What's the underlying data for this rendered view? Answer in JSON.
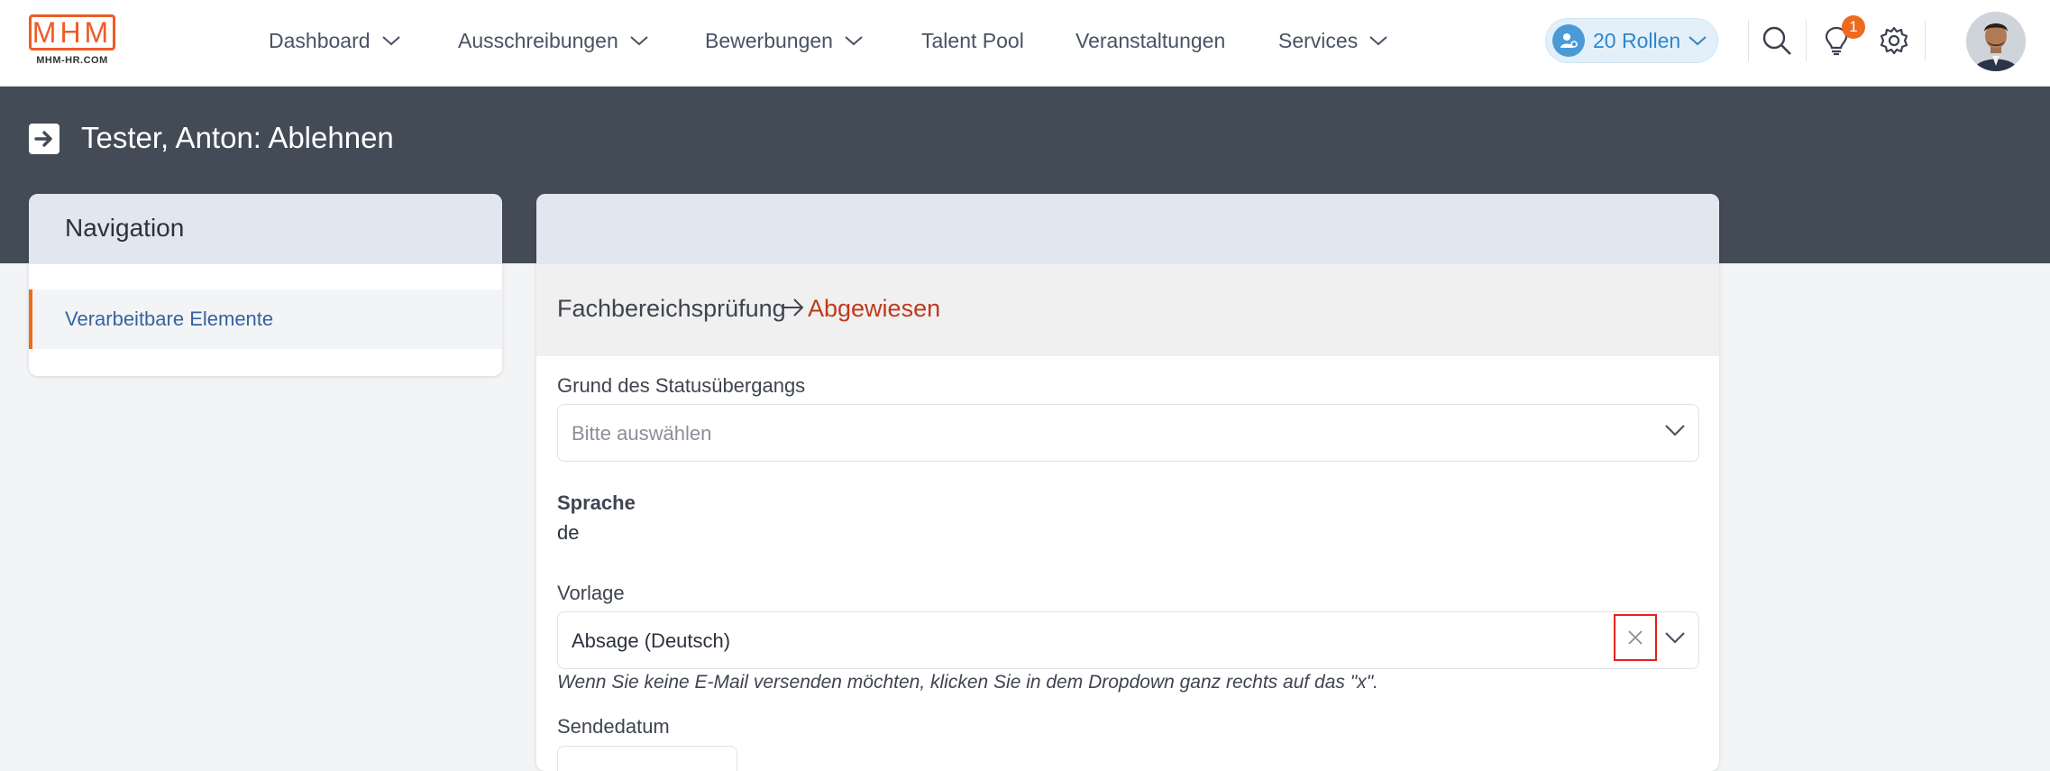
{
  "logo": {
    "letters": "MHM",
    "sub": "MHM-HR.COM"
  },
  "nav": {
    "items": [
      {
        "label": "Dashboard",
        "dropdown": true
      },
      {
        "label": "Ausschreibungen",
        "dropdown": true
      },
      {
        "label": "Bewerbungen",
        "dropdown": true
      },
      {
        "label": "Talent Pool",
        "dropdown": false
      },
      {
        "label": "Veranstaltungen",
        "dropdown": false
      },
      {
        "label": "Services",
        "dropdown": true
      }
    ],
    "roles_label": "20 Rollen",
    "notification_count": "1"
  },
  "page": {
    "title": "Tester, Anton: Ablehnen"
  },
  "sidebar": {
    "title": "Navigation",
    "items": [
      {
        "label": "Verarbeitbare Elemente"
      }
    ]
  },
  "form": {
    "status_from": "Fachbereichsprüfung",
    "status_to": "Abgewiesen",
    "reason_label": "Grund des Statusübergangs",
    "reason_placeholder": "Bitte auswählen",
    "language_label": "Sprache",
    "language_value": "de",
    "template_label": "Vorlage",
    "template_value": "Absage (Deutsch)",
    "template_hint": "Wenn Sie keine E-Mail versenden möchten, klicken Sie in dem Dropdown ganz rechts auf das \"x\".",
    "send_date_label": "Sendedatum"
  },
  "colors": {
    "brand_orange": "#ef5b26",
    "header_dark": "#434b56",
    "status_red": "#c1391b",
    "link_blue": "#3563a0",
    "highlight_red": "#e2231a"
  },
  "icons": {
    "search": "search-icon",
    "bulb": "lightbulb-icon",
    "settings": "gear-icon",
    "page": "arrow-right-box-icon",
    "clear": "close-icon"
  }
}
